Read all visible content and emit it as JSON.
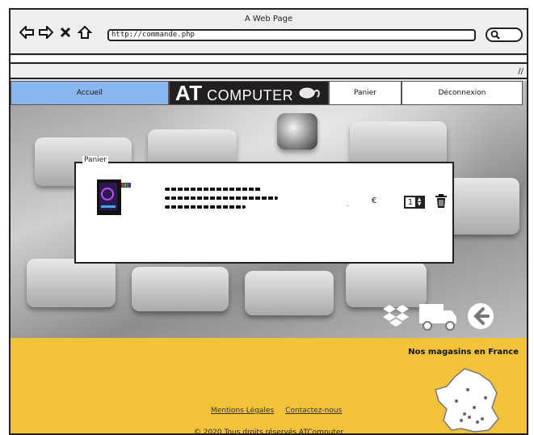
{
  "window": {
    "title": "A Web Page",
    "url": "http://commande.php"
  },
  "nav": {
    "home": "Accueil",
    "brand_at": "AT",
    "brand_rest": "COMPUTER",
    "cart": "Panier",
    "logout": "Déconnexion"
  },
  "cart": {
    "legend": "Panier",
    "item": {
      "image_icon": "gaming-pc-tower",
      "price_placeholder": "..",
      "currency": "€",
      "quantity": "1"
    }
  },
  "icons": {
    "dropbox": "dropbox-icon",
    "truck": "delivery-truck-icon",
    "back": "back-arrow-icon"
  },
  "footer": {
    "stores_title": "Nos magasins en France",
    "links": [
      "Mentions Légales",
      "Contactez-nous"
    ],
    "copyright": "© 2020 Tous droits réservés ATComputer"
  },
  "colors": {
    "home_button": "#8ab6f0",
    "brand_bg": "#231f1f",
    "footer_bg": "#f2c33a"
  }
}
